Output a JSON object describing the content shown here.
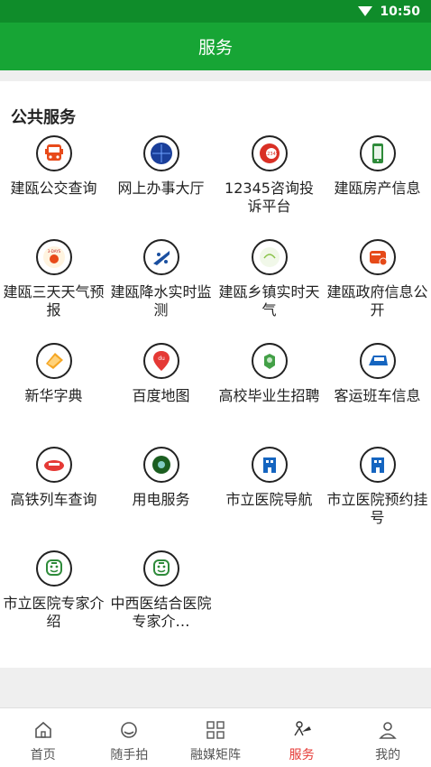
{
  "status": {
    "time": "10:50"
  },
  "header": {
    "title": "服务"
  },
  "section": {
    "title": "公共服务"
  },
  "services": [
    {
      "label": "建瓯公交查询",
      "icon": "bus-icon"
    },
    {
      "label": "网上办事大厅",
      "icon": "online-hall-icon"
    },
    {
      "label": "12345咨询投诉平台",
      "icon": "hotline-12345-icon"
    },
    {
      "label": "建瓯房产信息",
      "icon": "house-info-icon"
    },
    {
      "label": "建瓯三天天气预报",
      "icon": "weather-forecast-icon"
    },
    {
      "label": "建瓯降水实时监测",
      "icon": "rainfall-monitor-icon"
    },
    {
      "label": "建瓯乡镇实时天气",
      "icon": "town-weather-icon"
    },
    {
      "label": "建瓯政府信息公开",
      "icon": "gov-info-icon"
    },
    {
      "label": "新华字典",
      "icon": "dictionary-icon"
    },
    {
      "label": "百度地图",
      "icon": "baidu-map-icon"
    },
    {
      "label": "高校毕业生招聘",
      "icon": "graduate-recruit-icon"
    },
    {
      "label": "客运班车信息",
      "icon": "coach-bus-icon"
    },
    {
      "label": "高铁列车查询",
      "icon": "high-speed-rail-icon"
    },
    {
      "label": "用电服务",
      "icon": "electricity-icon"
    },
    {
      "label": "市立医院导航",
      "icon": "hospital-nav-icon"
    },
    {
      "label": "市立医院预约挂号",
      "icon": "hospital-booking-icon"
    },
    {
      "label": "市立医院专家介绍",
      "icon": "doctor-intro-icon"
    },
    {
      "label": "中西医结合医院专家介…",
      "icon": "doctor-intro-icon"
    }
  ],
  "tabs": [
    {
      "label": "首页",
      "icon": "home-icon",
      "active": false
    },
    {
      "label": "随手拍",
      "icon": "snapshot-icon",
      "active": false
    },
    {
      "label": "融媒矩阵",
      "icon": "grid-icon",
      "active": false
    },
    {
      "label": "服务",
      "icon": "service-icon",
      "active": true
    },
    {
      "label": "我的",
      "icon": "profile-icon",
      "active": false
    }
  ],
  "colors": {
    "statusbar": "#0f8c2a",
    "appbar": "#17a535",
    "active_tab": "#e53935"
  }
}
